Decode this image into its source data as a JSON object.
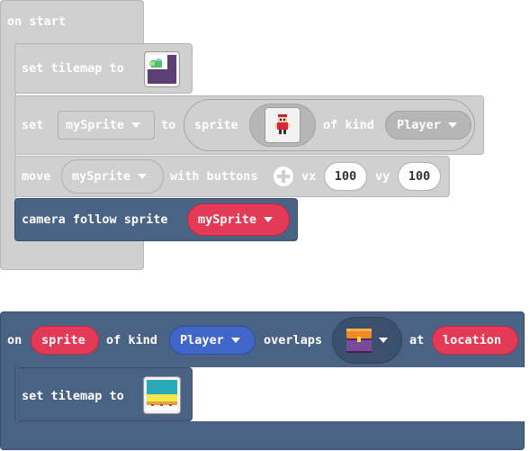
{
  "block1": {
    "hat": "on start",
    "set_tilemap": {
      "label": "set tilemap to"
    },
    "set_sprite": {
      "set": "set",
      "var": "mySprite",
      "to": "to",
      "sprite": "sprite",
      "of_kind": "of kind",
      "kind": "Player"
    },
    "move": {
      "move": "move",
      "var": "mySprite",
      "with_buttons": "with buttons",
      "vx_label": "vx",
      "vx": "100",
      "vy_label": "vy",
      "vy": "100"
    },
    "camera": {
      "label": "camera follow sprite",
      "var": "mySprite"
    }
  },
  "block2": {
    "on": "on",
    "sprite_var": "sprite",
    "of_kind": "of kind",
    "kind": "Player",
    "overlaps": "overlaps",
    "at": "at",
    "location_var": "location",
    "set_tilemap": {
      "label": "set tilemap to"
    }
  },
  "colors": {
    "event_gray": "#d0d0d0",
    "scene_slate": "#4a6384",
    "variable_red": "#e33b57",
    "kind_blue": "#3f66c8"
  }
}
